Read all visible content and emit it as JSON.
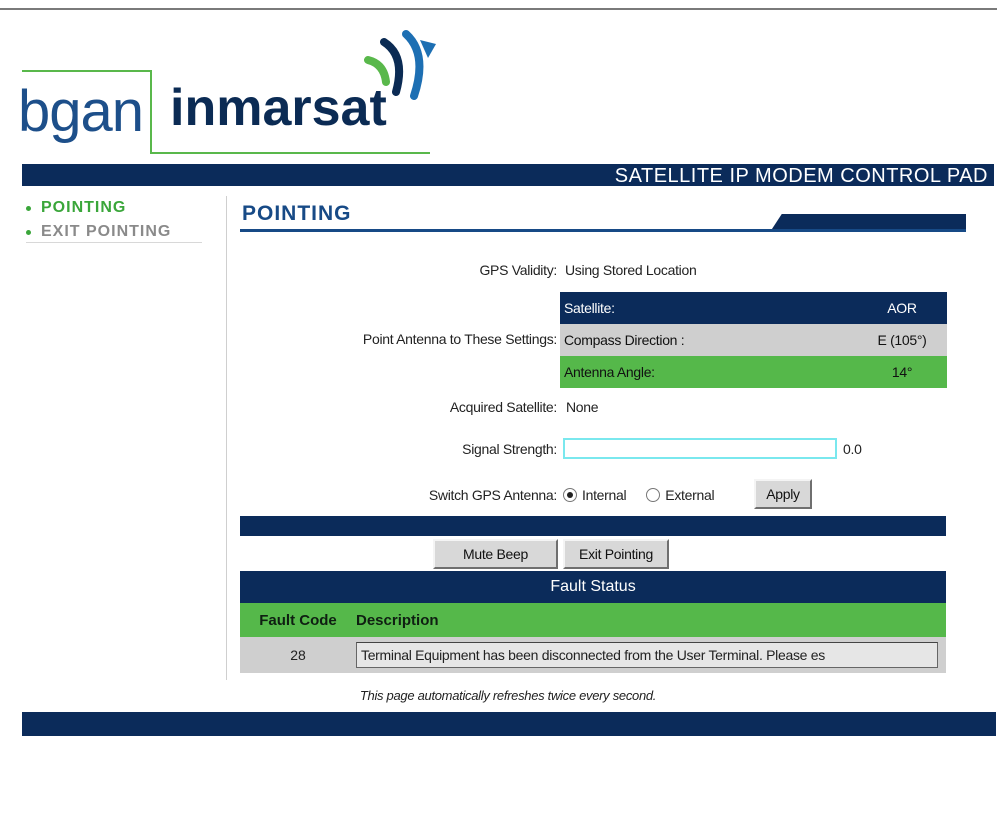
{
  "brand": {
    "bgan": "bgan",
    "inmarsat": "inmarsat",
    "banner_title": "SATELLITE IP MODEM CONTROL PAD"
  },
  "header_links": [
    "",
    ""
  ],
  "nav": [
    {
      "label": "POINTING",
      "active": true
    },
    {
      "label": "EXIT POINTING",
      "active": false
    }
  ],
  "page": {
    "title": "POINTING"
  },
  "gps": {
    "label": "GPS Validity:",
    "value": "Using Stored Location"
  },
  "point_settings": {
    "label": "Point Antenna to These Settings:",
    "rows": [
      {
        "key": "Satellite:",
        "value": "AOR"
      },
      {
        "key": "Compass Direction :",
        "value": "E (105°)"
      },
      {
        "key": "Antenna Angle:",
        "value": "14°"
      }
    ]
  },
  "acquired": {
    "label": "Acquired Satellite:",
    "value": "None"
  },
  "signal": {
    "label": "Signal Strength:",
    "value": "0.0",
    "level": 0.0
  },
  "gps_antenna": {
    "label": "Switch GPS Antenna:",
    "options": [
      "Internal",
      "External"
    ],
    "selected": "Internal",
    "apply_label": "Apply"
  },
  "actions": {
    "mute_label": "Mute Beep",
    "exit_label": "Exit Pointing"
  },
  "fault": {
    "heading": "Fault Status",
    "col_code": "Fault Code",
    "col_desc": "Description",
    "rows": [
      {
        "code": "28",
        "description": "Terminal Equipment has been disconnected from the User Terminal.  Please es"
      }
    ]
  },
  "refresh_note": "This page automatically refreshes twice every second.",
  "colors": {
    "navy": "#0b2b5a",
    "green": "#55b84a",
    "title_blue": "#174a86",
    "signal_border": "#7ae8ee"
  }
}
